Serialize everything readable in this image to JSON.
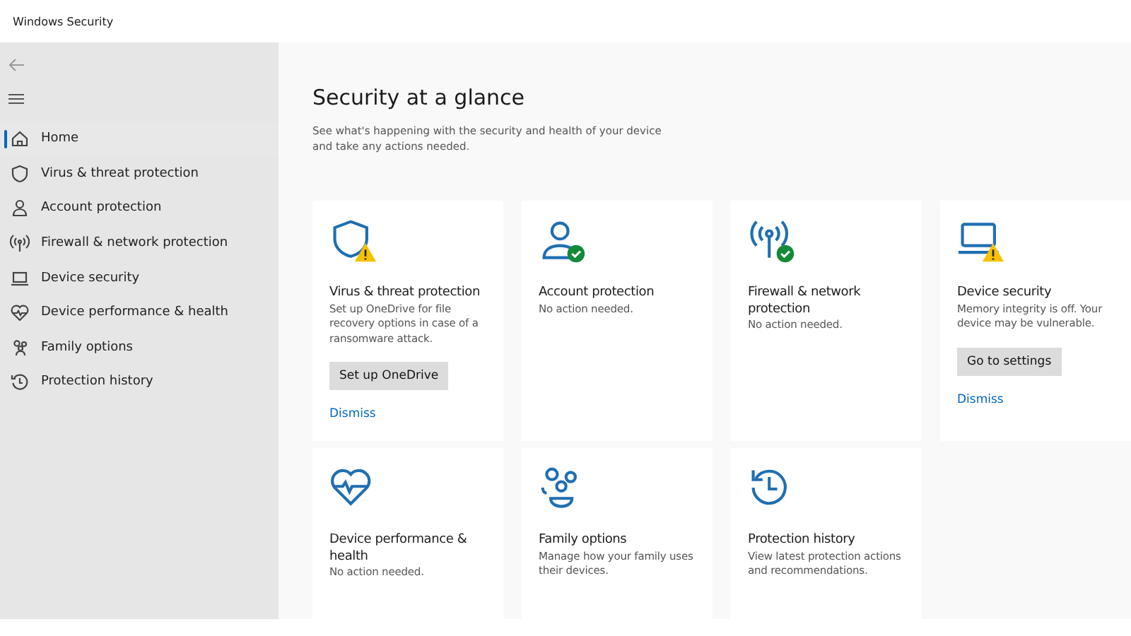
{
  "window": {
    "title": "Windows Security"
  },
  "sidebar": {
    "items": [
      {
        "label": "Home",
        "selected": true
      },
      {
        "label": "Virus & threat protection",
        "selected": false
      },
      {
        "label": "Account protection",
        "selected": false
      },
      {
        "label": "Firewall & network protection",
        "selected": false
      },
      {
        "label": "Device security",
        "selected": false
      },
      {
        "label": "Device performance & health",
        "selected": false
      },
      {
        "label": "Family options",
        "selected": false
      },
      {
        "label": "Protection history",
        "selected": false
      }
    ]
  },
  "page": {
    "title": "Security at a glance",
    "subtitle": "See what's happening with the security and health of your device and take any actions needed."
  },
  "cards": [
    {
      "title": "Virus & threat protection",
      "description": "Set up OneDrive for file recovery options in case of a ransomware attack.",
      "kind": "warning",
      "button": "Set up OneDrive",
      "link": "Dismiss"
    },
    {
      "title": "Account protection",
      "description": "No action needed.",
      "kind": "ok"
    },
    {
      "title": "Firewall & network protection",
      "description": "No action needed.",
      "kind": "ok"
    },
    {
      "title": "Device security",
      "description": "Memory integrity is off. Your device may be vulnerable.",
      "kind": "warning",
      "button": "Go to settings",
      "link": "Dismiss"
    },
    {
      "title": "Device performance & health",
      "description": "No action needed.",
      "kind": "plain"
    },
    {
      "title": "Family options",
      "description": "Manage how your family uses their devices.",
      "kind": "plain"
    },
    {
      "title": "Protection history",
      "description": "View latest protection actions and recommendations.",
      "kind": "plain"
    }
  ]
}
